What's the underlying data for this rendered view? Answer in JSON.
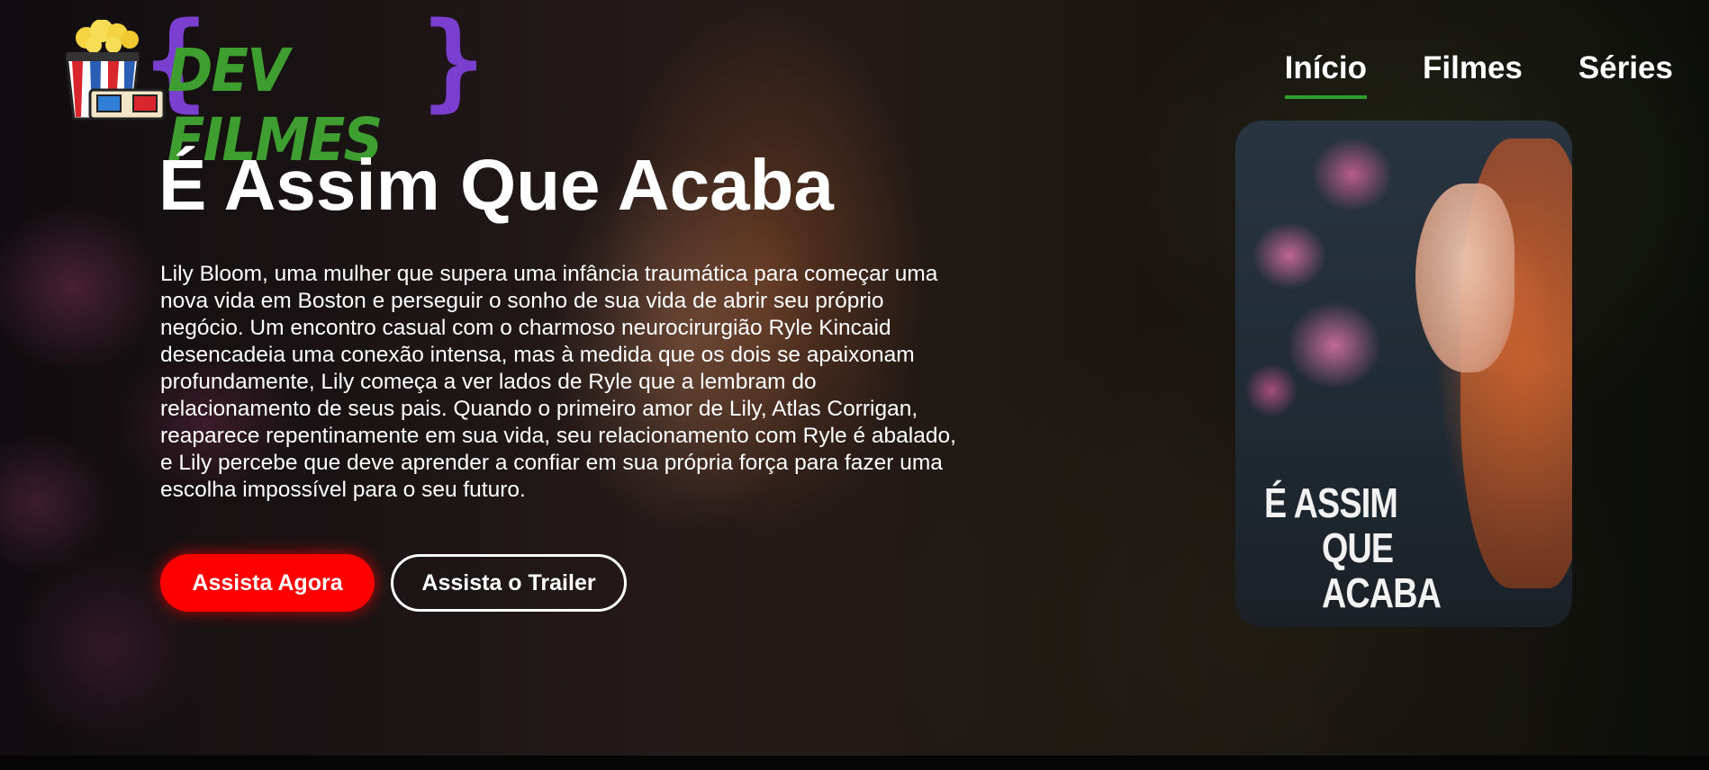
{
  "brand": {
    "name": "DEV FILMES",
    "icon": "popcorn-3d-glasses-icon"
  },
  "nav": {
    "items": [
      {
        "label": "Início",
        "active": true
      },
      {
        "label": "Filmes",
        "active": false
      },
      {
        "label": "Séries",
        "active": false
      }
    ]
  },
  "hero": {
    "title": "É Assim Que Acaba",
    "synopsis": "Lily Bloom, uma mulher que supera uma infância traumática para começar uma nova vida em Boston e perseguir o sonho de sua vida de abrir seu próprio negócio. Um encontro casual com o charmoso neurocirurgião Ryle Kincaid desencadeia uma conexão intensa, mas à medida que os dois se apaixonam profundamente, Lily começa a ver lados de Ryle que a lembram do relacionamento de seus pais. Quando o primeiro amor de Lily, Atlas Corrigan, reaparece repentinamente em sua vida, seu relacionamento com Ryle é abalado, e Lily percebe que deve aprender a confiar em sua própria força para fazer uma escolha impossível para o seu futuro.",
    "watch_button": "Assista Agora",
    "trailer_button": "Assista o Trailer"
  },
  "poster": {
    "line1": "É ASSIM",
    "line2": "QUE ACABA"
  },
  "colors": {
    "accent_green": "#2f9e2f",
    "primary_red": "#ff0000",
    "logo_purple": "#7b3fd0"
  }
}
